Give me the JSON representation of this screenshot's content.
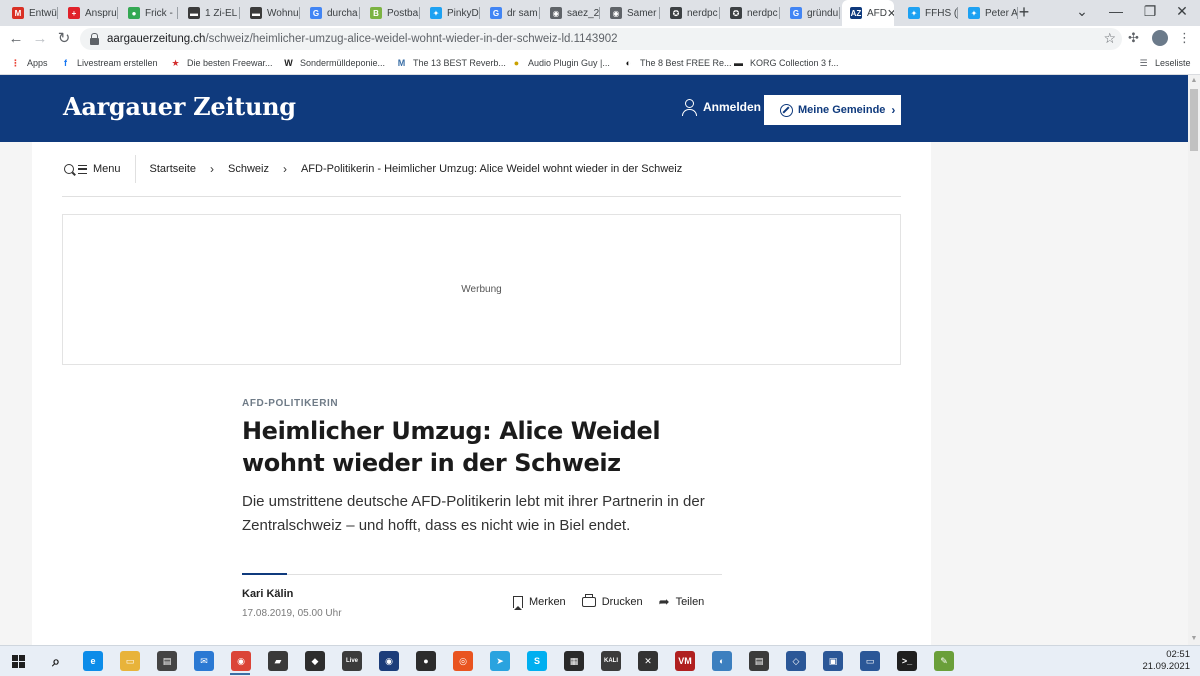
{
  "browser": {
    "tabs": [
      {
        "title": "Entwür",
        "icon": "gmail-icon",
        "color": "#d93025",
        "glyph": "M"
      },
      {
        "title": "Anspru",
        "icon": "swiss-flag-icon",
        "color": "#e0212a",
        "glyph": "+"
      },
      {
        "title": "Frick -",
        "icon": "maps-pin-icon",
        "color": "#34a853",
        "glyph": "●"
      },
      {
        "title": "1 Zi-EL",
        "icon": "listing-icon",
        "color": "#3b3b3b",
        "glyph": "▬"
      },
      {
        "title": "Wohnu",
        "icon": "listing-icon",
        "color": "#3b3b3b",
        "glyph": "▬"
      },
      {
        "title": "durcha",
        "icon": "google-icon",
        "color": "#4285f4",
        "glyph": "G"
      },
      {
        "title": "Postba",
        "icon": "postbank-icon",
        "color": "#7cb342",
        "glyph": "B"
      },
      {
        "title": "PinkyD",
        "icon": "twitter-icon",
        "color": "#1da1f2",
        "glyph": "✦"
      },
      {
        "title": "dr sam",
        "icon": "google-icon",
        "color": "#4285f4",
        "glyph": "G"
      },
      {
        "title": "saez_2",
        "icon": "globe-icon",
        "color": "#5f6368",
        "glyph": "◉"
      },
      {
        "title": "Samer",
        "icon": "globe-icon",
        "color": "#5f6368",
        "glyph": "◉"
      },
      {
        "title": "nerdpc",
        "icon": "star-circle-icon",
        "color": "#3c4043",
        "glyph": "✪"
      },
      {
        "title": "nerdpc",
        "icon": "star-circle-icon",
        "color": "#3c4043",
        "glyph": "✪"
      },
      {
        "title": "gründu",
        "icon": "google-icon",
        "color": "#4285f4",
        "glyph": "G"
      },
      {
        "title": "AFD",
        "icon": "az-icon",
        "color": "#0f3a7d",
        "glyph": "AZ",
        "active": true
      },
      {
        "title": "FFHS (",
        "icon": "twitter-icon",
        "color": "#1da1f2",
        "glyph": "✦"
      },
      {
        "title": "Peter A",
        "icon": "twitter-icon",
        "color": "#1da1f2",
        "glyph": "✦"
      }
    ],
    "close_tab_glyph": "✕",
    "new_tab_glyph": "+",
    "url_host": "aargauerzeitung.ch",
    "url_path": "/schweiz/heimlicher-umzug-alice-weidel-wohnt-wieder-in-der-schweiz-ld.1143902",
    "bookmarks": [
      {
        "label": "Apps",
        "icon": "apps-grid-icon",
        "color": "#ea4335",
        "glyph": "⋮"
      },
      {
        "label": "Livestream erstellen",
        "icon": "facebook-icon",
        "color": "#1877f2",
        "glyph": "f"
      },
      {
        "label": "Die besten Freewar...",
        "icon": "star-icon",
        "color": "#d32f2f",
        "glyph": "★"
      },
      {
        "label": "Sondermülldeponie...",
        "icon": "wikipedia-icon",
        "color": "#222222",
        "glyph": "W"
      },
      {
        "label": "The 13 BEST Reverb...",
        "icon": "bookmark-site-icon",
        "color": "#3a6ea5",
        "glyph": "M"
      },
      {
        "label": "Audio Plugin Guy |...",
        "icon": "plugin-guy-icon",
        "color": "#c9a100",
        "glyph": "●"
      },
      {
        "label": "The 8 Best FREE Re...",
        "icon": "bookmark-site-icon",
        "color": "#111111",
        "glyph": "◐"
      },
      {
        "label": "KORG Collection 3 f...",
        "icon": "korg-icon",
        "color": "#222222",
        "glyph": "▬"
      }
    ],
    "reading_list": "Leseliste"
  },
  "site": {
    "logo": "Aargauer Zeitung",
    "login": "Anmelden",
    "gemeinde": "Meine Gemeinde",
    "menu": "Menu",
    "breadcrumbs": [
      "Startseite",
      "Schweiz",
      "AFD-Politikerin - Heimlicher Umzug: Alice Weidel wohnt wieder in der Schweiz"
    ],
    "ad_label": "Werbung",
    "brand_color": "#0f3a7d"
  },
  "article": {
    "kicker": "AFD-POLITIKERIN",
    "headline": "Heimlicher Umzug: Alice Weidel wohnt wieder in der Schweiz",
    "lead": "Die umstrittene deutsche AFD-Politikerin lebt mit ihrer Partnerin in der Zentralschweiz – und hofft, dass es nicht wie in Biel endet.",
    "author": "Kari Kälin",
    "date": "17.08.2019, 05.00 Uhr",
    "actions": {
      "save": "Merken",
      "print": "Drucken",
      "share": "Teilen"
    }
  },
  "taskbar": {
    "time": "02:51",
    "date": "21.09.2021",
    "apps": [
      {
        "name": "search-taskbar-icon",
        "color": "#1f1f1f",
        "glyph": "⌕"
      },
      {
        "name": "edge-icon",
        "color": "#0c8ce9",
        "glyph": "e"
      },
      {
        "name": "file-explorer-icon",
        "color": "#e8b33a",
        "glyph": "▭"
      },
      {
        "name": "store-icon",
        "color": "#444444",
        "glyph": "▤"
      },
      {
        "name": "mail-icon",
        "color": "#2b79d3",
        "glyph": "✉"
      },
      {
        "name": "chrome-icon",
        "color": "#db4437",
        "glyph": "◉"
      },
      {
        "name": "app-icon",
        "color": "#3a3a3a",
        "glyph": "▰"
      },
      {
        "name": "app-icon",
        "color": "#2d2d2d",
        "glyph": "◆"
      },
      {
        "name": "live-icon",
        "color": "#3b3b3b",
        "glyph": "Live"
      },
      {
        "name": "app-icon",
        "color": "#1c3d7a",
        "glyph": "◉"
      },
      {
        "name": "app-icon",
        "color": "#2c2c2c",
        "glyph": "●"
      },
      {
        "name": "ubuntu-icon",
        "color": "#e95420",
        "glyph": "◎"
      },
      {
        "name": "telegram-icon",
        "color": "#2aa3df",
        "glyph": "➤"
      },
      {
        "name": "skype-icon",
        "color": "#00aff0",
        "glyph": "S"
      },
      {
        "name": "app-icon",
        "color": "#2a2a2a",
        "glyph": "▦"
      },
      {
        "name": "kali-icon",
        "color": "#3b3b3b",
        "glyph": "KALI"
      },
      {
        "name": "app-icon",
        "color": "#333333",
        "glyph": "✕"
      },
      {
        "name": "voicemeeter-icon",
        "color": "#b02020",
        "glyph": "VM"
      },
      {
        "name": "app-icon",
        "color": "#3c7fbf",
        "glyph": "◐"
      },
      {
        "name": "app-icon",
        "color": "#3b3b3b",
        "glyph": "▤"
      },
      {
        "name": "virtualbox-icon",
        "color": "#2b5797",
        "glyph": "◇"
      },
      {
        "name": "app-icon",
        "color": "#2b5797",
        "glyph": "▣"
      },
      {
        "name": "app-icon",
        "color": "#2b5797",
        "glyph": "▭"
      },
      {
        "name": "terminal-icon",
        "color": "#1f1f1f",
        "glyph": ">_"
      },
      {
        "name": "notepad-icon",
        "color": "#6a9f3a",
        "glyph": "✎"
      }
    ]
  }
}
